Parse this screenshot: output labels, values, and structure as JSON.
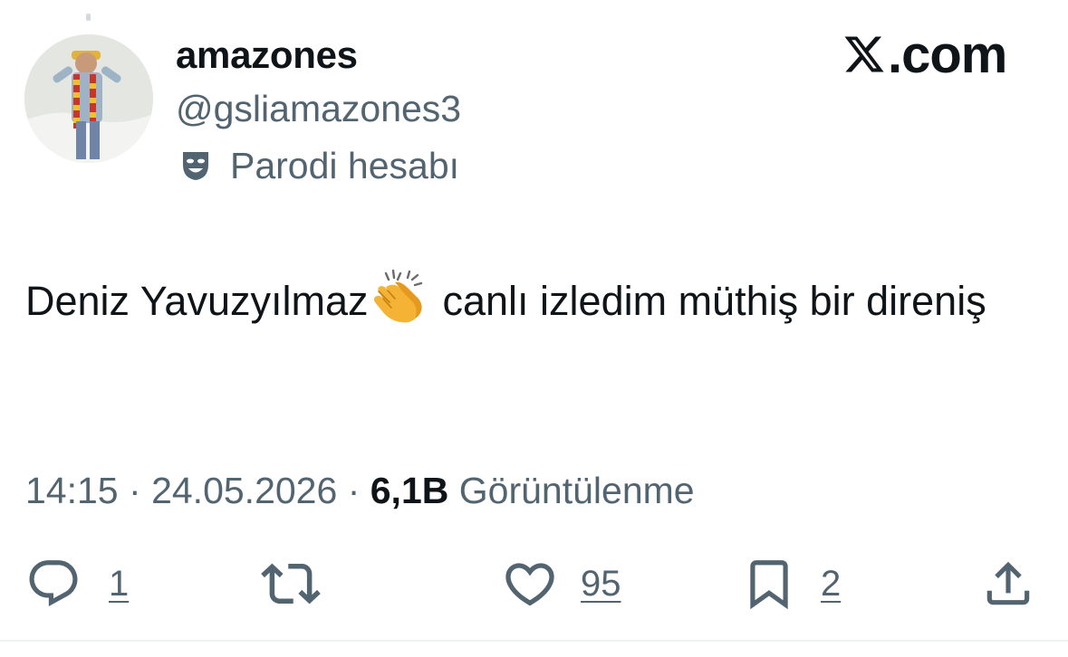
{
  "author": {
    "display_name": "amazones",
    "handle": "@gsliamazones3",
    "label": "Parodi hesabı",
    "label_icon": "theater-mask-icon",
    "avatar_icon": "profile-photo"
  },
  "brand": {
    "logo_icon": "x-logo-icon",
    "suffix": ".com"
  },
  "tweet": {
    "text_before_emoji": "Deniz Yavuzyılmaz",
    "emoji": "clapping-hands-icon",
    "text_after_emoji": "canlı izledim müthiş bir direniş"
  },
  "meta": {
    "time": "14:15",
    "separator": "·",
    "date": "24.05.2026",
    "views_count": "6,1B",
    "views_label": "Görüntülenme"
  },
  "actions": {
    "reply_count": "1",
    "retweet_count": "",
    "like_count": "95",
    "bookmark_count": "2"
  },
  "colors": {
    "text_primary": "#0f1419",
    "text_secondary": "#536471",
    "divider": "#eff3f4"
  }
}
